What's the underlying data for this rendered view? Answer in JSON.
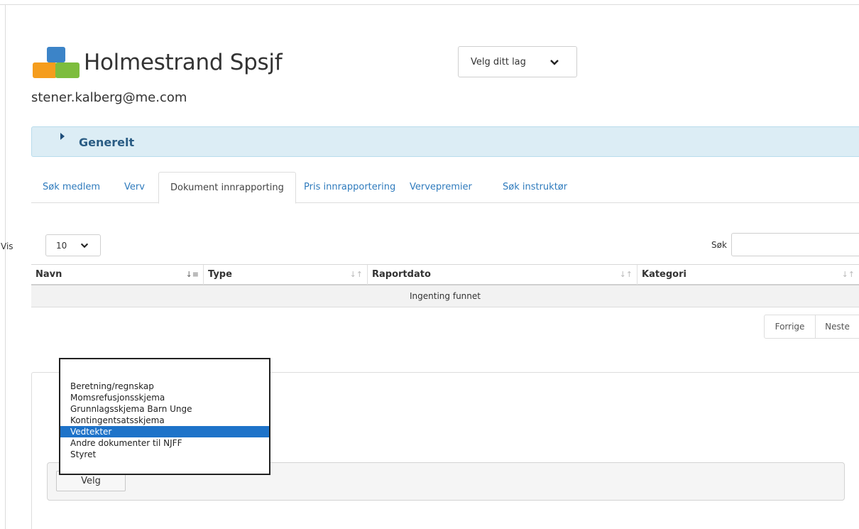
{
  "header": {
    "org_name": "Holmestrand Spsjf",
    "user_email": "stener.kalberg@me.com",
    "team_select": {
      "selected": "Velg ditt lag"
    }
  },
  "panel": {
    "title": "Generelt"
  },
  "tabs": [
    {
      "label": "Søk medlem",
      "active": false
    },
    {
      "label": "Verv",
      "active": false
    },
    {
      "label": "Dokument innrapporting",
      "active": true
    },
    {
      "label": "Pris innrapportering",
      "active": false
    },
    {
      "label": "Vervepremier",
      "active": false
    },
    {
      "label": "Søk instruktør",
      "active": false
    }
  ],
  "table_controls": {
    "length_label": "Vis",
    "length_value": "10",
    "search_label": "Søk",
    "search_value": ""
  },
  "table": {
    "columns": [
      "Navn",
      "Type",
      "Raportdato",
      "Kategori"
    ],
    "sorted_column": "Navn",
    "empty_text": "Ingenting funnet"
  },
  "pagination": {
    "prev": "Forrige",
    "next": "Neste"
  },
  "category_dropdown": {
    "options": [
      "Beretning/regnskap",
      "Momsrefusjonsskjema",
      "Grunnlagsskjema Barn Unge",
      "Kontingentsatsskjema",
      "Vedtekter",
      "Andre dokumenter til NJFF",
      "Styret"
    ],
    "highlighted": "Vedtekter"
  },
  "form": {
    "select_button": "Velg"
  },
  "colors": {
    "link": "#2f7bbd",
    "panel_bg": "#dcedf5",
    "highlight": "#1e73c9",
    "logo_blue": "#3c84c8",
    "logo_orange": "#f59d1d",
    "logo_green": "#7dbd3d"
  }
}
